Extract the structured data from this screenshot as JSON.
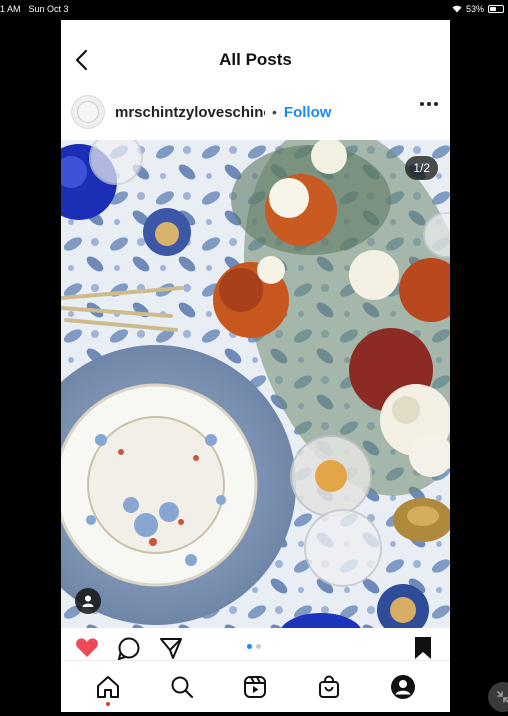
{
  "status": {
    "time": "1 AM",
    "date": "Sun Oct 3",
    "battery": "53%",
    "battery_level": 0.53
  },
  "header": {
    "title": "All Posts"
  },
  "post": {
    "username": "mrschintzyloveschinoiserie",
    "separator": "•",
    "follow_label": "Follow",
    "counter": "1/2",
    "liked": true,
    "carousel_active_index": 0,
    "carousel_count": 2
  },
  "colors": {
    "follow": "#1a8cf0",
    "like": "#ed4956",
    "active_dot": "#1a8cf0",
    "inactive_dot": "#c8c8c8",
    "nav_notification": "#e33"
  },
  "icons": {
    "back": "chevron-left-icon",
    "more": "ellipsis-icon",
    "tag": "user-tag-icon",
    "like": "heart-icon",
    "comment": "comment-icon",
    "share": "send-icon",
    "save": "bookmark-icon",
    "nav": [
      "home-icon",
      "search-icon",
      "reels-icon",
      "shop-icon",
      "profile-icon"
    ]
  }
}
